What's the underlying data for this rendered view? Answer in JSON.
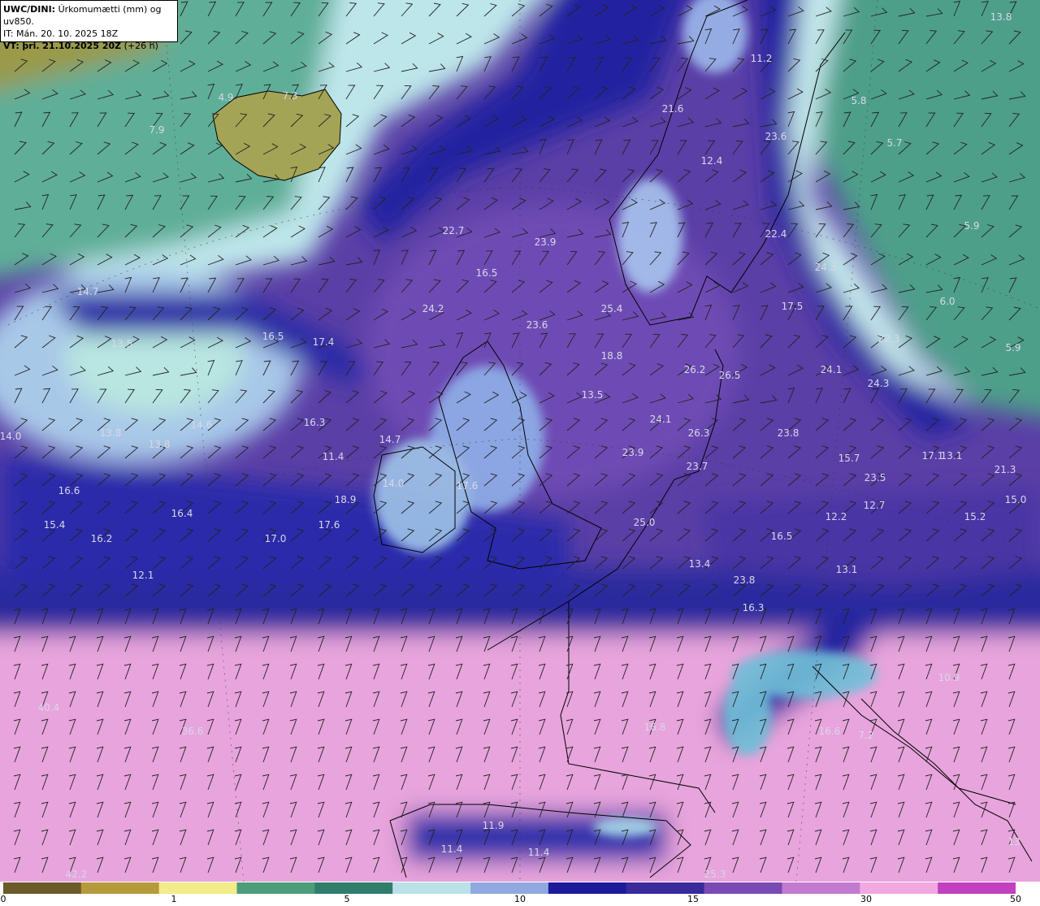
{
  "header": {
    "model": "UWC/DINI:",
    "field": "Úrkomumætti (mm) og uv850.",
    "it_line": "IT: Mán. 20. 10. 2025 18Z",
    "vt_prefix": "VT:",
    "vt_line": "þri. 21.10.2025 20Z",
    "vt_suffix": "(+26 h)"
  },
  "colorbar": {
    "ticks": [
      "0",
      "1",
      "5",
      "10",
      "15",
      "30",
      "50"
    ],
    "colors": [
      "#6b5a2a",
      "#b59a3c",
      "#f2ec8a",
      "#4d9c7c",
      "#2f7d6a",
      "#b9e2e8",
      "#8fa8e0",
      "#1c1c9a",
      "#3a2a9a",
      "#7a4ab4",
      "#c27ad0",
      "#f2a8e0",
      "#c040c0"
    ]
  },
  "values": [
    "13.8",
    "11.2",
    "21.6",
    "23.6",
    "5.8",
    "5.7",
    "4.9",
    "7.3",
    "7.9",
    "12.4",
    "22.7",
    "23.9",
    "16.5",
    "22.4",
    "24.3",
    "5.9",
    "14.7",
    "24.2",
    "25.4",
    "17.5",
    "6.0",
    "23.6",
    "18.8",
    "22.3",
    "16.5",
    "17.4",
    "13.5",
    "26.2",
    "26.5",
    "24.1",
    "5.9",
    "24.3",
    "13.5",
    "14.0",
    "13.8",
    "13.8",
    "14.6",
    "16.3",
    "14.7",
    "24.1",
    "26.3",
    "23.8",
    "11.4",
    "23.9",
    "15.7",
    "17.1",
    "13.1",
    "16.6",
    "23.7",
    "21.3",
    "14.0",
    "17.6",
    "18.9",
    "15.4",
    "16.2",
    "16.4",
    "17.0",
    "17.6",
    "25.0",
    "23.5",
    "15.0",
    "12.7",
    "12.2",
    "15.2",
    "16.5",
    "12.1",
    "13.4",
    "23.8",
    "13.1",
    "16.3",
    "10.9",
    "40.4",
    "36.6",
    "16.8",
    "16.6",
    "7.2",
    "11.9",
    "11.4",
    "11.4",
    "42.2",
    "25.3",
    "13"
  ],
  "map_colors": {
    "ocean_dry": "#6fb8a4",
    "moist_light": "#c8ecf0",
    "moist_blue": "#1a1a96",
    "purple": "#6a48ae",
    "pink": "#e8a4dc",
    "land_dry": "#c6b25e"
  }
}
